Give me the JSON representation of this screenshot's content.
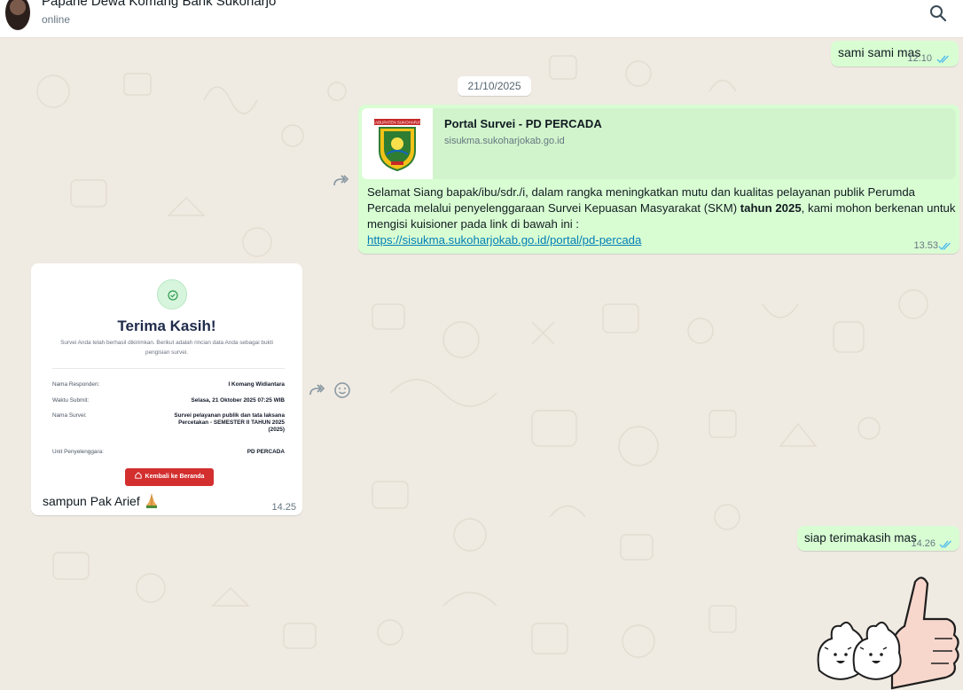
{
  "header": {
    "contact_name": "Papahe Dewa Komang Bank Sukoharjo",
    "status": "online"
  },
  "messages": {
    "m1": {
      "text": "sami sami mas",
      "time": "12.10"
    },
    "date_chip": "21/10/2025",
    "m2": {
      "preview_title": "Portal Survei - PD PERCADA",
      "preview_domain": "sisukma.sukoharjokab.go.id",
      "thumb_label": "KABUPATEN SUKOHARJO",
      "body_before": "Selamat Siang bapak/ibu/sdr./i, dalam rangka meningkatkan mutu dan kualitas pelayanan publik Perumda Percada melalui penyelenggaraan Survei Kepuasan Masyarakat (SKM) ",
      "body_bold": "tahun 2025",
      "body_after": ", kami mohon berkenan untuk mengisi kuisioner pada link di bawah ini :",
      "link": "https://sisukma.sukoharjokab.go.id/portal/pd-percada",
      "time": "13.53"
    },
    "m3": {
      "card_title": "Terima Kasih!",
      "card_subtitle": "Survei Anda telah berhasil dikirimkan. Berikut adalah rincian data Anda sebagai bukti pengisian survei.",
      "rows": [
        {
          "key": "Nama Responden:",
          "value": "I Komang Widiantara"
        },
        {
          "key": "Waktu Submit:",
          "value": "Selasa, 21 Oktober 2025 07:25 WIB"
        },
        {
          "key": "Nama Survei:",
          "value": "Survei pelayanan publik dan tata laksana Percetakan - SEMESTER II TAHUN 2025 (2025)"
        },
        {
          "key": "Unit Penyelenggara:",
          "value": "PD PERCADA"
        }
      ],
      "card_button": "Kembali ke Beranda",
      "caption": "sampun Pak Arief",
      "time": "14.25"
    },
    "m4": {
      "text": "siap terimakasih mas",
      "time": "14.26"
    }
  },
  "icons": {
    "search": "search-icon",
    "forward": "forward-icon",
    "emoji": "emoji-reaction-icon",
    "ticks": "double-check-read-icon",
    "check": "check-circle-icon",
    "home": "home-icon",
    "pray": "praying-hands-emoji",
    "sticker": "thumbs-up-sticker"
  },
  "colors": {
    "outgoing": "#d9fdd3",
    "incoming": "#ffffff",
    "wallpaper": "#efeae2",
    "read_ticks": "#53bdeb",
    "link": "#027eb5",
    "card_button": "#d32f2f"
  }
}
